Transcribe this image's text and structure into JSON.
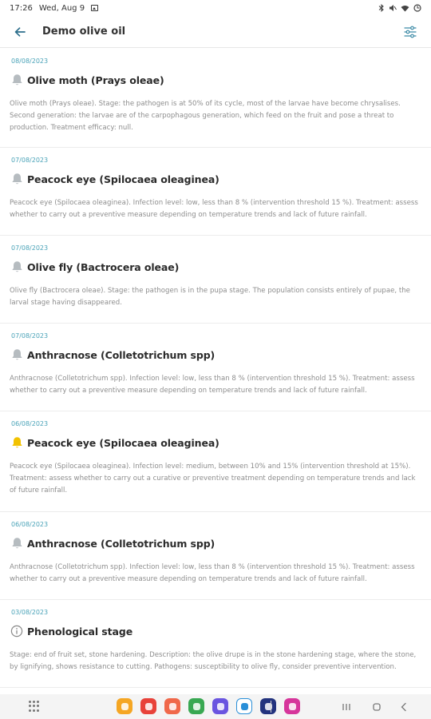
{
  "status_bar": {
    "time": "17:26",
    "date": "Wed, Aug 9"
  },
  "header": {
    "title": "Demo olive oil"
  },
  "alerts": [
    {
      "date": "08/08/2023",
      "icon": "bell-icon",
      "color": "#b6bcc0",
      "title": "Olive moth (Prays oleae)",
      "description": "Olive moth (Prays oleae). Stage: the pathogen is at 50% of its cycle, most of the larvae have become chrysalises. Second generation: the larvae are of the carpophagous generation, which feed on the fruit and pose a threat to production. Treatment efficacy: null."
    },
    {
      "date": "07/08/2023",
      "icon": "bell-icon",
      "color": "#b6bcc0",
      "title": "Peacock eye (Spilocaea oleaginea)",
      "description": "Peacock eye (Spilocaea oleaginea). Infection level: low, less than 8 % (intervention threshold 15 %). Treatment: assess whether to carry out a preventive measure depending on temperature trends and lack of future rainfall."
    },
    {
      "date": "07/08/2023",
      "icon": "bell-icon",
      "color": "#b6bcc0",
      "title": "Olive fly (Bactrocera oleae)",
      "description": "Olive fly (Bactrocera oleae). Stage: the pathogen is in the pupa stage. The population consists entirely of pupae, the larval stage having disappeared."
    },
    {
      "date": "07/08/2023",
      "icon": "bell-icon",
      "color": "#b6bcc0",
      "title": "Anthracnose (Colletotrichum spp)",
      "description": "Anthracnose (Colletotrichum spp). Infection level: low, less than 8 % (intervention threshold 15 %). Treatment: assess whether to carry out a preventive measure depending on temperature trends and lack of future rainfall."
    },
    {
      "date": "06/08/2023",
      "icon": "bell-icon",
      "color": "#f2c200",
      "title": "Peacock eye (Spilocaea oleaginea)",
      "description": "Peacock eye (Spilocaea oleaginea). Infection level: medium, between 10% and 15% (intervention threshold at 15%). Treatment: assess whether to carry out a curative or preventive treatment depending on temperature trends and lack of future rainfall."
    },
    {
      "date": "06/08/2023",
      "icon": "bell-icon",
      "color": "#b6bcc0",
      "title": "Anthracnose (Colletotrichum spp)",
      "description": "Anthracnose (Colletotrichum spp). Infection level: low, less than 8 % (intervention threshold 15 %). Treatment: assess whether to carry out a preventive measure depending on temperature trends and lack of future rainfall."
    },
    {
      "date": "03/08/2023",
      "icon": "info-icon",
      "color": "#8a8a8a",
      "title": "Phenological stage",
      "description": "Stage: end of fruit set, stone hardening. Description: the olive drupe is in the stone hardening stage, where the stone, by lignifying, shows resistance to cutting. Pathogens: susceptibility to olive fly, consider preventive intervention."
    }
  ],
  "dock_apps": [
    {
      "name": "files-app",
      "color": "#f5a623"
    },
    {
      "name": "flipboard-app",
      "color": "#e8423a"
    },
    {
      "name": "contacts-app",
      "color": "#f0684a"
    },
    {
      "name": "games-app",
      "color": "#39a852"
    },
    {
      "name": "internet-app",
      "color": "#6a55e0"
    },
    {
      "name": "notes-app",
      "color": "#ffffff"
    },
    {
      "name": "settings-app",
      "color": "#23337e"
    },
    {
      "name": "blossom-app",
      "color": "#d6359b"
    }
  ]
}
